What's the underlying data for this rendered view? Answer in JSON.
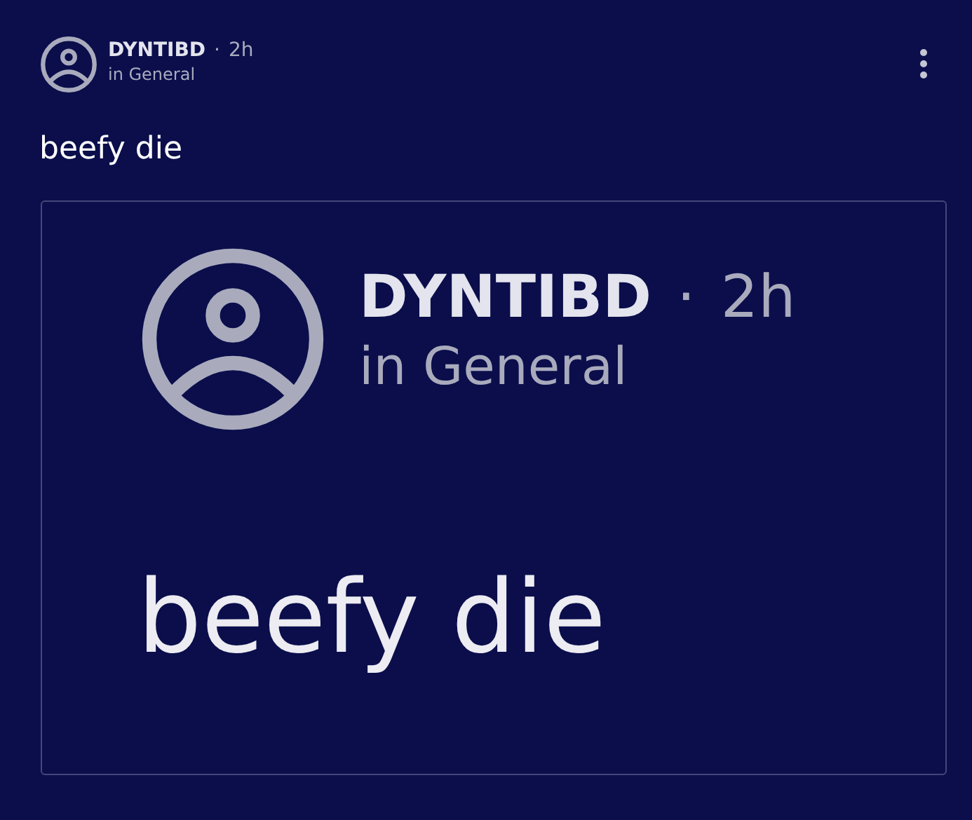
{
  "post": {
    "author": "DYNTIBD",
    "separator": "·",
    "time": "2h",
    "channel": "in General",
    "text": "beefy die",
    "attachment": {
      "kind": "screenshot",
      "author": "DYNTIBD",
      "separator": "·",
      "time": "2h",
      "channel": "in General",
      "text": "beefy die"
    }
  }
}
